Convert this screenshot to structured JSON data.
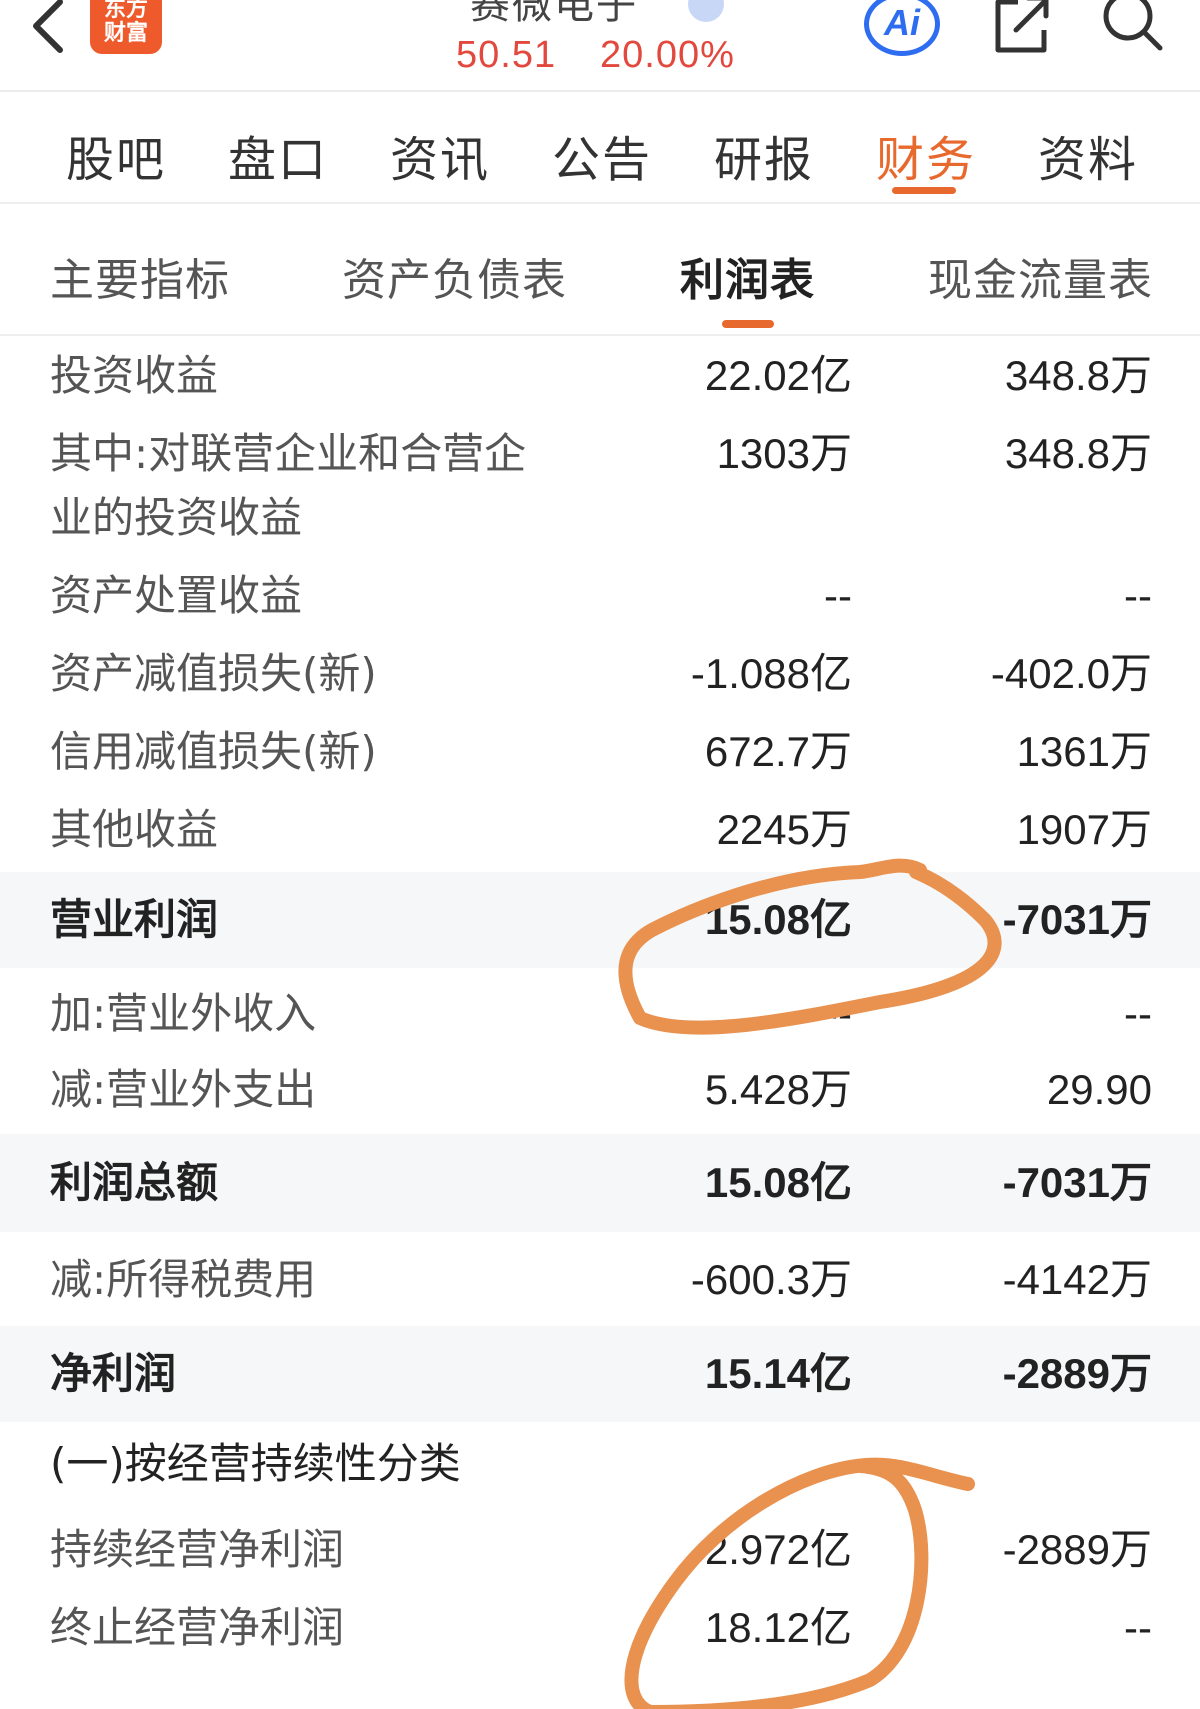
{
  "header": {
    "logo_line1": "东方",
    "logo_line2": "财富",
    "stock_name": "赛微电子",
    "price": "50.51",
    "change_pct": "20.00%",
    "ai_label": "Ai"
  },
  "main_tabs": [
    "股吧",
    "盘口",
    "资讯",
    "公告",
    "研报",
    "财务",
    "资料"
  ],
  "main_tabs_active": "财务",
  "sub_tabs": [
    "主要指标",
    "资产负债表",
    "利润表",
    "现金流量表"
  ],
  "sub_tabs_active": "利润表",
  "rows": [
    {
      "label": "投资收益",
      "v1": "22.02亿",
      "v2": "348.8万"
    },
    {
      "label": "其中:对联营企业和合营企",
      "label2": "业的投资收益",
      "v1": "1303万",
      "v2": "348.8万"
    },
    {
      "label": "资产处置收益",
      "v1": "--",
      "v2": "--"
    },
    {
      "label": "资产减值损失(新)",
      "v1": "-1.088亿",
      "v2": "-402.0万"
    },
    {
      "label": "信用减值损失(新)",
      "v1": "672.7万",
      "v2": "1361万"
    },
    {
      "label": "其他收益",
      "v1": "2245万",
      "v2": "1907万"
    },
    {
      "label": "营业利润",
      "v1": "15.08亿",
      "v2": "-7031万",
      "bold": true
    },
    {
      "label": "加:营业外收入",
      "v1": "--",
      "v2": "--"
    },
    {
      "label": "减:营业外支出",
      "v1": "5.428万",
      "v2": "29.90"
    },
    {
      "label": "利润总额",
      "v1": "15.08亿",
      "v2": "-7031万",
      "bold": true
    },
    {
      "label": "减:所得税费用",
      "v1": "-600.3万",
      "v2": "-4142万"
    },
    {
      "label": "净利润",
      "v1": "15.14亿",
      "v2": "-2889万",
      "bold": true
    },
    {
      "label": "(一)按经营持续性分类",
      "section": true
    },
    {
      "label": "持续经营净利润",
      "v1": "-2.972亿",
      "v2": "-2889万"
    },
    {
      "label": "终止经营净利润",
      "v1": "18.12亿",
      "v2": "--"
    }
  ],
  "colors": {
    "accent": "#e8692d",
    "price_red": "#e2483d",
    "ai_blue": "#2f6df0",
    "logo_orange": "#ef5a2c",
    "annotation": "#e9914e"
  }
}
